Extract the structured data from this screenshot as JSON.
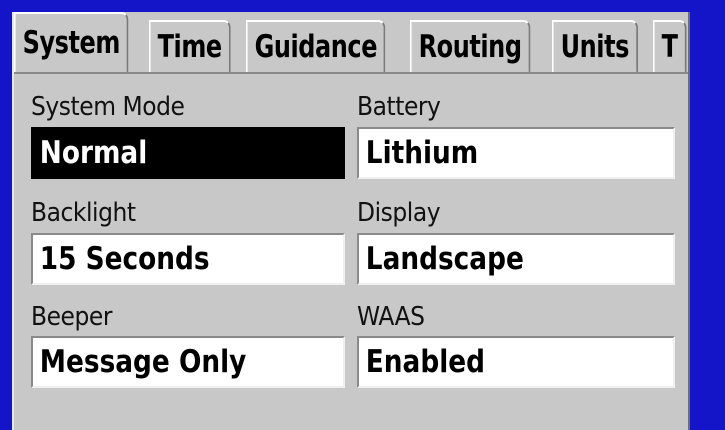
{
  "tabs": [
    "System",
    "Time",
    "Guidance",
    "Routing",
    "Units",
    "T"
  ],
  "active_tab": "System",
  "settings": {
    "system_mode": {
      "label": "System Mode",
      "value": "Normal"
    },
    "battery": {
      "label": "Battery",
      "value": "Lithium"
    },
    "backlight": {
      "label": "Backlight",
      "value": "15 Seconds"
    },
    "display": {
      "label": "Display",
      "value": "Landscape"
    },
    "beeper": {
      "label": "Beeper",
      "value": "Message Only"
    },
    "waas": {
      "label": "WAAS",
      "value": "Enabled"
    }
  },
  "colors": {
    "frame": "#1414c8",
    "panel": "#c8c8c8",
    "selected_field": "#000000",
    "field": "#ffffff"
  }
}
